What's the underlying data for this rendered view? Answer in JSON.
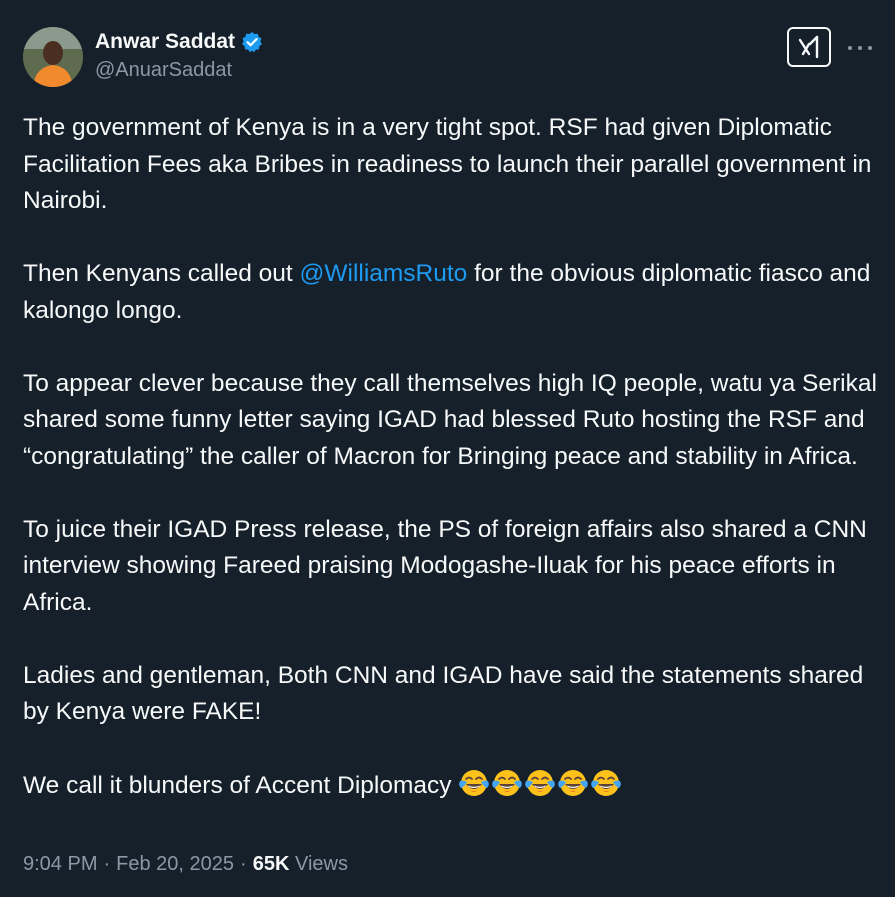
{
  "author": {
    "display_name": "Anwar Saddat",
    "handle": "@AnuarSaddat",
    "verified": true
  },
  "icons": {
    "verified": "verified-badge-icon",
    "grok": "grok-icon",
    "more": "more-icon",
    "emoji": "face-with-tears-of-joy-icon"
  },
  "colors": {
    "background": "#15202b",
    "text": "#f7f9f9",
    "secondary": "#8b98a5",
    "accent": "#1d9bf0"
  },
  "tweet": {
    "p1": "The government of Kenya is in a very tight spot. RSF had given Diplomatic Facilitation Fees aka Bribes in readiness to launch their parallel government in Nairobi.",
    "p2_before": "Then Kenyans called out ",
    "p2_mention": "@WilliamsRuto",
    "p2_after": " for the obvious diplomatic fiasco and kalongo longo.",
    "p3": "To appear clever because they call themselves high IQ people, watu ya Serikal shared some funny letter saying IGAD had blessed Ruto hosting the RSF and “congratulating” the caller of Macron for Bringing peace and stability in Africa.",
    "p4": "To juice their IGAD Press release, the PS of foreign affairs also shared a CNN interview showing Fareed  praising Modogashe-Iluak for his peace efforts in Africa.",
    "p5": "Ladies and gentleman, Both CNN and IGAD have said the statements shared by Kenya were FAKE!",
    "p6": "We call it blunders of Accent Diplomacy",
    "emoji_count": 5
  },
  "meta": {
    "time": "9:04 PM",
    "separator": "·",
    "date": "Feb 20, 2025",
    "views_count": "65K",
    "views_label": "Views"
  }
}
